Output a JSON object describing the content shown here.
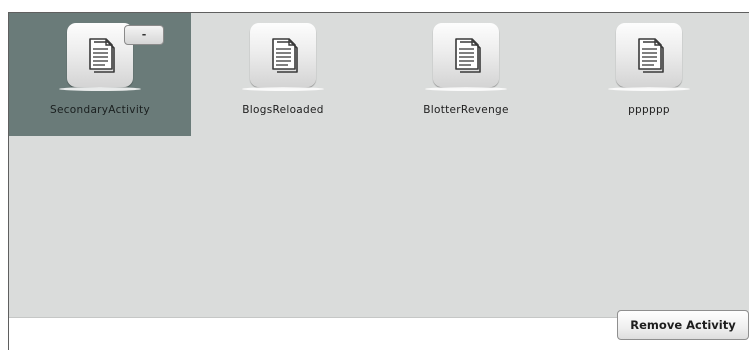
{
  "activities": [
    {
      "name": "SecondaryActivity",
      "selected": true,
      "icon": "document-icon"
    },
    {
      "name": "BlogsReloaded",
      "selected": false,
      "icon": "document-icon"
    },
    {
      "name": "BlotterRevenge",
      "selected": false,
      "icon": "document-icon"
    },
    {
      "name": "pppppp",
      "selected": false,
      "icon": "document-icon"
    }
  ],
  "selected_tile": {
    "remove_button_label": "-"
  },
  "footer": {
    "remove_activity_label": "Remove Activity"
  },
  "colors": {
    "grid_background": "#dadcdb",
    "selected_background": "#6a7b79",
    "page_background": "#ffffff"
  }
}
